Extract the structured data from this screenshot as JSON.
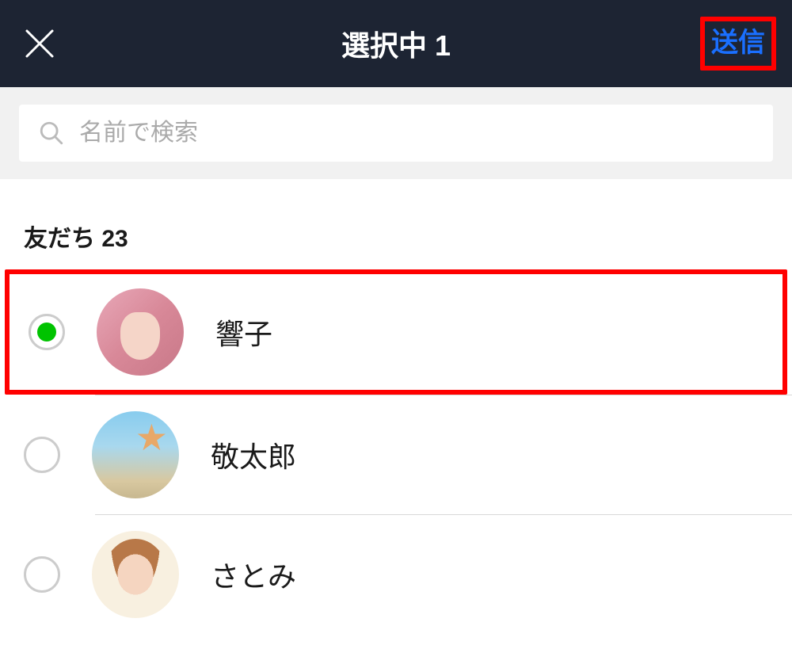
{
  "header": {
    "title": "選択中 1",
    "send_label": "送信"
  },
  "search": {
    "placeholder": "名前で検索"
  },
  "friends": {
    "section_label": "友だち 23",
    "items": [
      {
        "name": "響子",
        "selected": true,
        "highlighted": true
      },
      {
        "name": "敬太郎",
        "selected": false,
        "highlighted": false
      },
      {
        "name": "さとみ",
        "selected": false,
        "highlighted": false
      }
    ]
  },
  "colors": {
    "header_bg": "#1d2433",
    "accent_green": "#00c300",
    "send_blue": "#1a6fff",
    "highlight_red": "#ff0000"
  }
}
